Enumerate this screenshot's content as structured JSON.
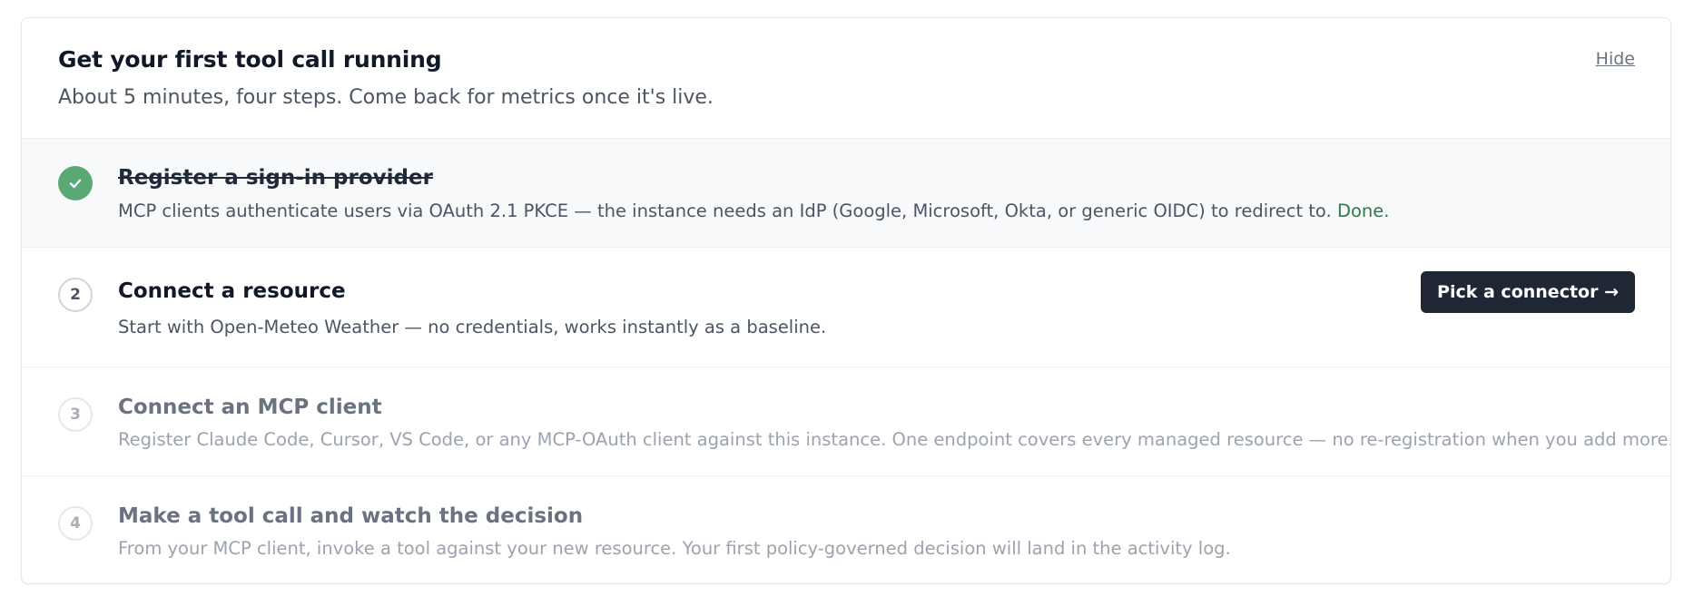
{
  "header": {
    "title": "Get your first tool call running",
    "subtitle": "About 5 minutes, four steps. Come back for metrics once it's live.",
    "hide_label": "Hide"
  },
  "steps": [
    {
      "number": "1",
      "status": "done",
      "title": "Register a sign-in provider",
      "description": "MCP clients authenticate users via OAuth 2.1 PKCE — the instance needs an IdP (Google, Microsoft, Okta, or generic OIDC) to redirect to.",
      "done_label": "Done."
    },
    {
      "number": "2",
      "status": "active",
      "title": "Connect a resource",
      "description": "Start with Open-Meteo Weather — no credentials, works instantly as a baseline.",
      "action_label": "Pick a connector →"
    },
    {
      "number": "3",
      "status": "pending",
      "title": "Connect an MCP client",
      "description": "Register Claude Code, Cursor, VS Code, or any MCP-OAuth client against this instance. One endpoint covers every managed resource — no re-registration when you add more."
    },
    {
      "number": "4",
      "status": "pending",
      "title": "Make a tool call and watch the decision",
      "description": "From your MCP client, invoke a tool against your new resource. Your first policy-governed decision will land in the activity log."
    }
  ],
  "icons": {
    "step_1_marker": "check-icon"
  },
  "colors": {
    "check": "#5aa874",
    "done_text": "#2f7a47",
    "button_bg": "#1f2735"
  }
}
